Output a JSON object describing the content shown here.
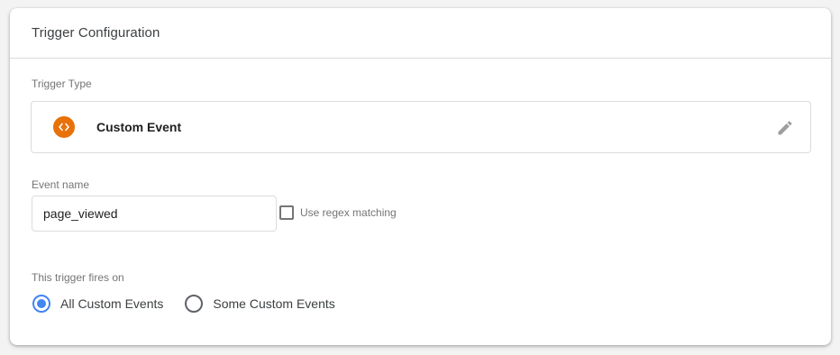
{
  "card": {
    "title": "Trigger Configuration"
  },
  "trigger_type": {
    "label": "Trigger Type",
    "icon": "custom-event-code-icon",
    "icon_color": "#e8710a",
    "name": "Custom Event",
    "edit_icon": "pencil-icon"
  },
  "event_name": {
    "label": "Event name",
    "value": "page_viewed",
    "regex_label": "Use regex matching",
    "regex_checked": false
  },
  "fires_on": {
    "label": "This trigger fires on",
    "options": [
      {
        "label": "All Custom Events",
        "selected": true
      },
      {
        "label": "Some Custom Events",
        "selected": false
      }
    ],
    "accent_color": "#4285f4"
  }
}
